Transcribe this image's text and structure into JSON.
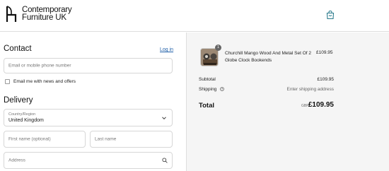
{
  "header": {
    "logo_line1": "Contemporary",
    "logo_line2": "Furniture UK"
  },
  "contact": {
    "title": "Contact",
    "login_label": "Log in",
    "email_placeholder": "Email or mobile phone number",
    "news_label": "Email me with news and offers"
  },
  "delivery": {
    "title": "Delivery",
    "country_label": "Country/Region",
    "country_value": "United Kingdom",
    "first_name_placeholder": "First name (optional)",
    "last_name_placeholder": "Last name",
    "address_placeholder": "Address"
  },
  "summary": {
    "product": {
      "name": "Churchill Mango Wood And Metal Set Of 2 Globe Clock Bookends",
      "price": "£109.95",
      "quantity": "1"
    },
    "subtotal_label": "Subtotal",
    "subtotal_value": "£109.95",
    "shipping_label": "Shipping",
    "shipping_value": "Enter shipping address",
    "total_label": "Total",
    "total_currency": "GBP",
    "total_value": "£109.95"
  },
  "colors": {
    "link": "#1f5fa8",
    "cart_icon": "#2a7a8c",
    "summary_bg": "#f5f5f5"
  }
}
